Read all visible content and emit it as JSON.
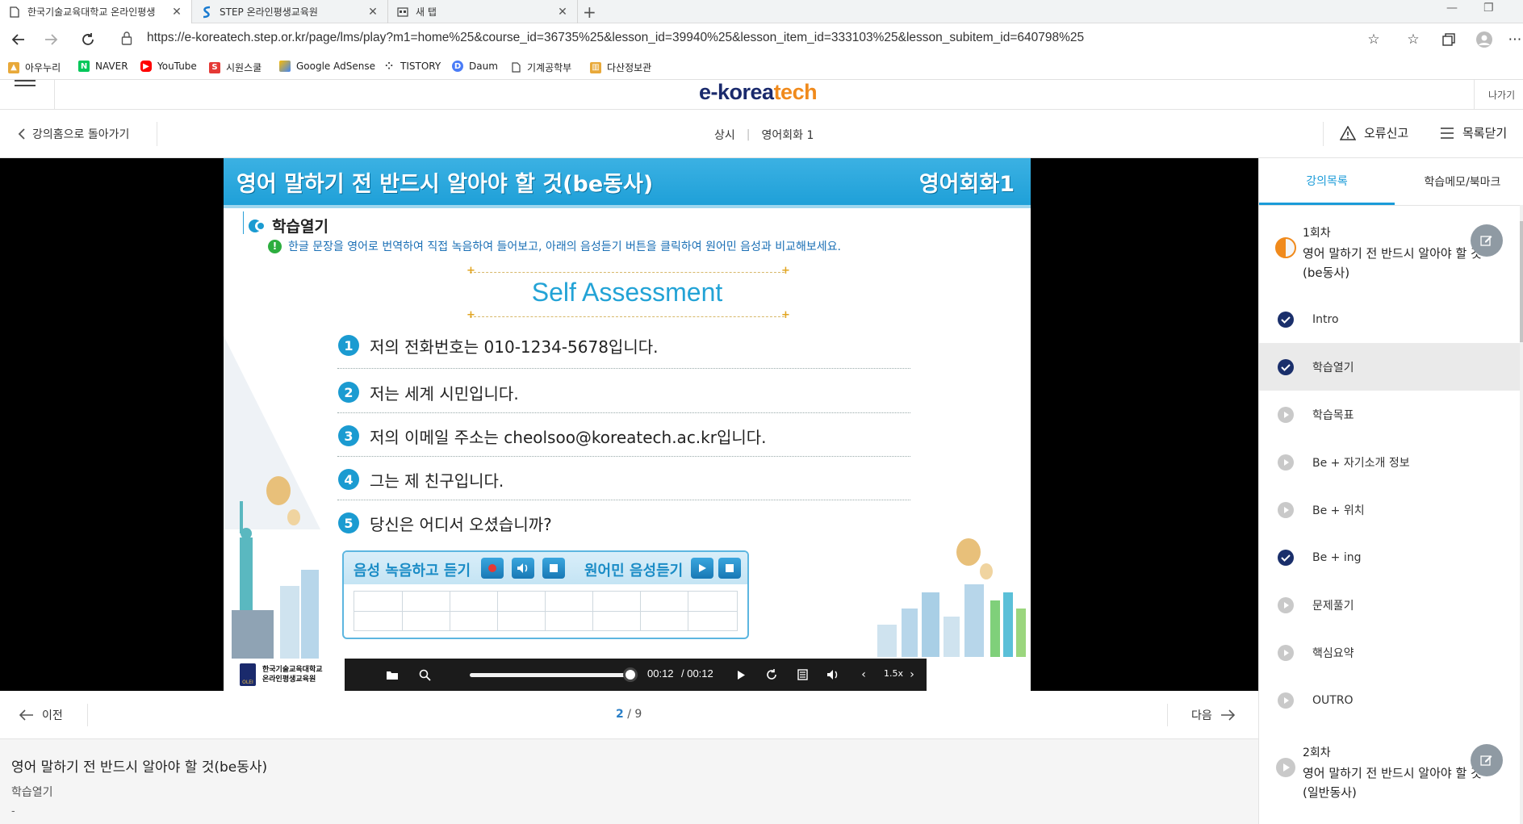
{
  "browser": {
    "tabs": [
      {
        "title": "한국기술교육대학교 온라인평생",
        "active": true
      },
      {
        "title": "STEP 온라인평생교육원",
        "active": false
      },
      {
        "title": "새 탭",
        "active": false
      }
    ],
    "url": "https://e-koreatech.step.or.kr/page/lms/play?m1=home%25&course_id=36735%25&lesson_id=39940%25&lesson_item_id=333103%25&lesson_subitem_id=640798%25",
    "bookmarks": [
      {
        "label": "아우누리",
        "icon": "bookmark-auri-icon",
        "color": "#e8a93a"
      },
      {
        "label": "NAVER",
        "icon": "naver-icon",
        "color": "#03c75a"
      },
      {
        "label": "YouTube",
        "icon": "youtube-icon",
        "color": "#ff0000"
      },
      {
        "label": "시원스쿨",
        "icon": "siwon-icon",
        "color": "#e53935"
      },
      {
        "label": "Google AdSense",
        "icon": "adsense-icon",
        "color": "#fbbc04"
      },
      {
        "label": "TISTORY",
        "icon": "tistory-icon",
        "color": "#333333"
      },
      {
        "label": "Daum",
        "icon": "daum-icon",
        "color": "#4a7cf7"
      },
      {
        "label": "기계공학부",
        "icon": "page-icon",
        "color": "#666666"
      },
      {
        "label": "다산정보관",
        "icon": "library-icon",
        "color": "#e8a93a"
      }
    ]
  },
  "site": {
    "logo_a": "e-korea",
    "logo_b": "tech",
    "exit": "나가기",
    "back": "강의홈으로 돌아가기",
    "crumb_1": "상시",
    "crumb_2": "영어회화 1",
    "report": "오류신고",
    "close_list": "목록닫기"
  },
  "slide": {
    "title": "영어 말하기 전 반드시 알아야 할 것(be동사)",
    "course": "영어회화1",
    "section": "학습열기",
    "instruction": "한글 문장을 영어로 번역하여 직접 녹음하여 들어보고, 아래의 음성듣기 버튼을 클릭하여 원어민 음성과 비교해보세요.",
    "heading": "Self Assessment",
    "questions": [
      {
        "no": "1",
        "text": "저의 전화번호는 010-1234-5678입니다."
      },
      {
        "no": "2",
        "text": "저는 세계 시민입니다."
      },
      {
        "no": "3",
        "text": "저의 이메일 주소는 cheolsoo@koreatech.ac.kr입니다."
      },
      {
        "no": "4",
        "text": "그는 제 친구입니다."
      },
      {
        "no": "5",
        "text": "당신은 어디서 오셨습니까?"
      }
    ],
    "record_label": "음성 녹음하고 듣기",
    "native_label": "원어민 음성듣기"
  },
  "player": {
    "logo_line1": "한국기술교육대학교",
    "logo_line2": "온라인평생교육원",
    "logo_seal": "OLEI",
    "current_time": "00:12",
    "duration": "/ 00:12",
    "progress": 1.0,
    "speed": "1.5x"
  },
  "pager": {
    "prev": "이전",
    "current": "2",
    "total": "/ 9",
    "next": "다음"
  },
  "info": {
    "title": "영어 말하기 전 반드시 알아야 할 것(be동사)",
    "subtitle": "학습열기",
    "desc": "-"
  },
  "panel": {
    "tab_list": "강의목록",
    "tab_memo": "학습메모/북마크",
    "lesson1_no": "1회차",
    "lesson1_title": "영어 말하기 전 반드시 알아야 할 것(be동사)",
    "items": [
      {
        "label": "Intro",
        "status": "done"
      },
      {
        "label": "학습열기",
        "status": "done"
      },
      {
        "label": "학습목표",
        "status": "pending"
      },
      {
        "label": "Be + 자기소개 정보",
        "status": "pending"
      },
      {
        "label": "Be + 위치",
        "status": "pending"
      },
      {
        "label": "Be + ing",
        "status": "done"
      },
      {
        "label": "문제풀기",
        "status": "pending"
      },
      {
        "label": "핵심요약",
        "status": "pending"
      },
      {
        "label": "OUTRO",
        "status": "pending"
      }
    ],
    "lesson2_no": "2회차",
    "lesson2_title": "영어 말하기 전 반드시 알아야 할 것(일반동사)"
  },
  "colors": {
    "accent": "#1a9bd8",
    "done": "#1a2f6b",
    "pending": "#c9c9c9"
  }
}
